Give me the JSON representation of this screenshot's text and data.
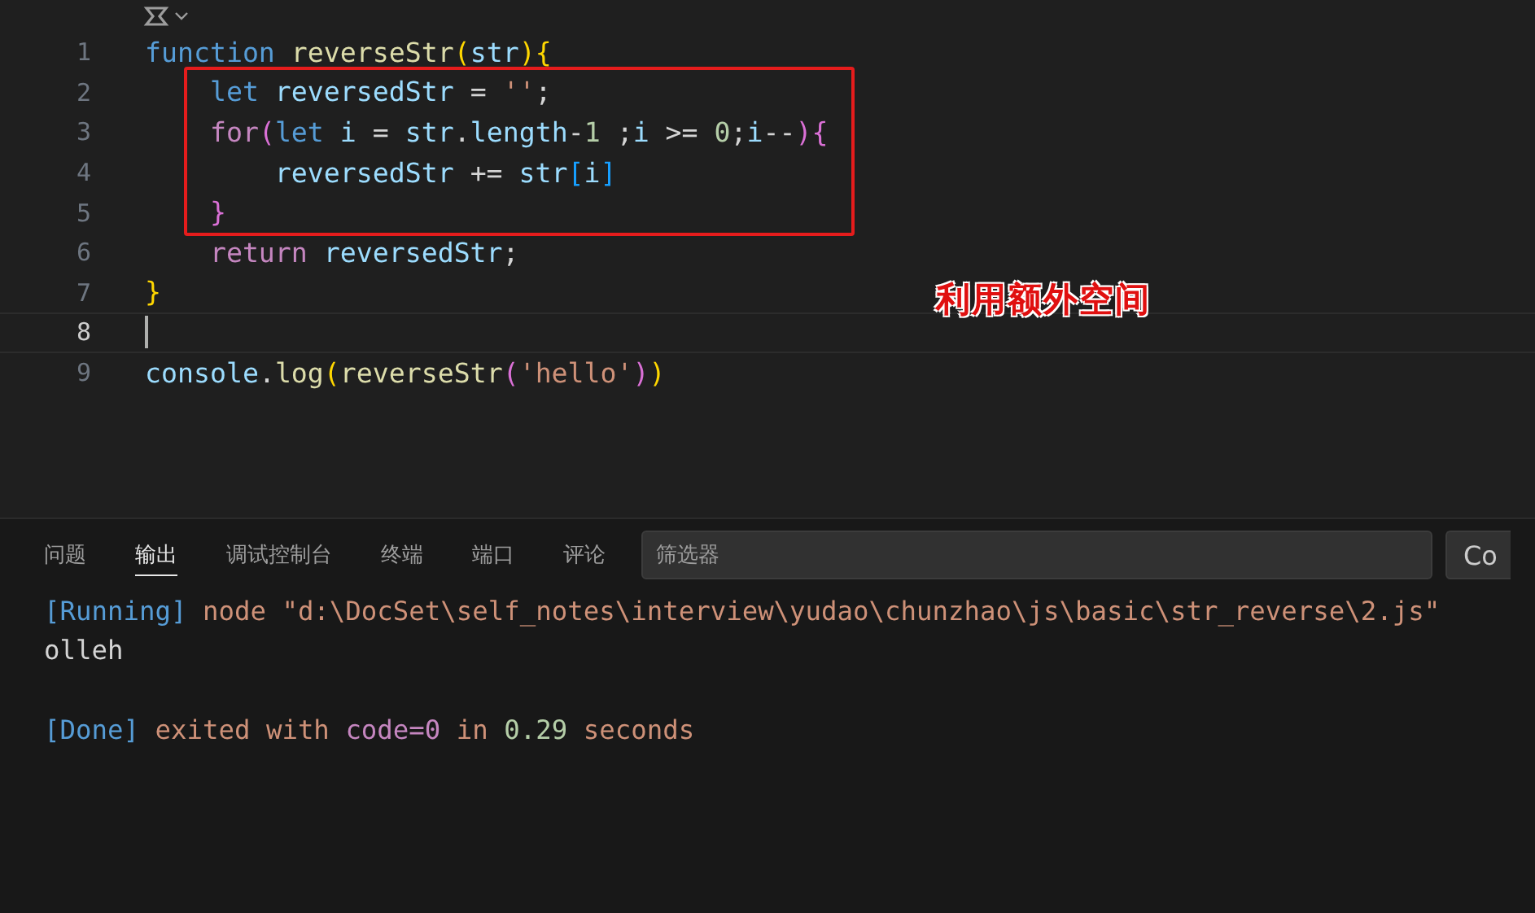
{
  "editor": {
    "lines": [
      {
        "number": "1",
        "current": false,
        "tokens": [
          {
            "text": "function",
            "kind": "keyword"
          },
          {
            "text": " reverseStr",
            "kind": "function"
          },
          {
            "text": "(",
            "kind": "bracket1"
          },
          {
            "text": "str",
            "kind": "variable"
          },
          {
            "text": ")",
            "kind": "bracket1"
          },
          {
            "text": "{",
            "kind": "bracket1"
          }
        ]
      },
      {
        "number": "2",
        "current": false,
        "tokens": [
          {
            "text": "    let",
            "kind": "keyword"
          },
          {
            "text": " reversedStr",
            "kind": "variable"
          },
          {
            "text": " = ",
            "kind": "plain"
          },
          {
            "text": "''",
            "kind": "string"
          },
          {
            "text": ";",
            "kind": "plain"
          }
        ]
      },
      {
        "number": "3",
        "current": false,
        "tokens": [
          {
            "text": "    for",
            "kind": "control"
          },
          {
            "text": "(",
            "kind": "bracket2"
          },
          {
            "text": "let",
            "kind": "keyword"
          },
          {
            "text": " i",
            "kind": "variable"
          },
          {
            "text": " = ",
            "kind": "plain"
          },
          {
            "text": "str",
            "kind": "variable"
          },
          {
            "text": ".",
            "kind": "plain"
          },
          {
            "text": "length",
            "kind": "variable"
          },
          {
            "text": "-",
            "kind": "plain"
          },
          {
            "text": "1",
            "kind": "number"
          },
          {
            "text": " ;",
            "kind": "plain"
          },
          {
            "text": "i",
            "kind": "variable"
          },
          {
            "text": " >= ",
            "kind": "plain"
          },
          {
            "text": "0",
            "kind": "number"
          },
          {
            "text": ";",
            "kind": "plain"
          },
          {
            "text": "i",
            "kind": "variable"
          },
          {
            "text": "--",
            "kind": "plain"
          },
          {
            "text": ")",
            "kind": "bracket2"
          },
          {
            "text": "{",
            "kind": "bracket2"
          }
        ]
      },
      {
        "number": "4",
        "current": false,
        "tokens": [
          {
            "text": "        reversedStr",
            "kind": "variable"
          },
          {
            "text": " += ",
            "kind": "plain"
          },
          {
            "text": "str",
            "kind": "variable"
          },
          {
            "text": "[",
            "kind": "bracket3"
          },
          {
            "text": "i",
            "kind": "variable"
          },
          {
            "text": "]",
            "kind": "bracket3"
          }
        ]
      },
      {
        "number": "5",
        "current": false,
        "tokens": [
          {
            "text": "    }",
            "kind": "bracket2"
          }
        ]
      },
      {
        "number": "6",
        "current": false,
        "tokens": [
          {
            "text": "    return",
            "kind": "control"
          },
          {
            "text": " reversedStr",
            "kind": "variable"
          },
          {
            "text": ";",
            "kind": "plain"
          }
        ]
      },
      {
        "number": "7",
        "current": false,
        "tokens": [
          {
            "text": "}",
            "kind": "bracket1"
          }
        ]
      },
      {
        "number": "8",
        "current": true
      },
      {
        "number": "9",
        "current": false,
        "tokens": [
          {
            "text": "console",
            "kind": "variable"
          },
          {
            "text": ".",
            "kind": "plain"
          },
          {
            "text": "log",
            "kind": "function"
          },
          {
            "text": "(",
            "kind": "bracket1"
          },
          {
            "text": "reverseStr",
            "kind": "function"
          },
          {
            "text": "(",
            "kind": "bracket2"
          },
          {
            "text": "'hello'",
            "kind": "string"
          },
          {
            "text": ")",
            "kind": "bracket2"
          },
          {
            "text": ")",
            "kind": "bracket1"
          }
        ]
      }
    ]
  },
  "annotation": {
    "text": "利用额外空间"
  },
  "panel": {
    "tabs": [
      {
        "label": "问题",
        "selected": false
      },
      {
        "label": "输出",
        "selected": true
      },
      {
        "label": "调试控制台",
        "selected": false
      },
      {
        "label": "终端",
        "selected": false
      },
      {
        "label": "端口",
        "selected": false
      },
      {
        "label": "评论",
        "selected": false
      }
    ],
    "filter": {
      "placeholder": "筛选器"
    },
    "button": "Co",
    "output": [
      {
        "kind": "text",
        "segments": [
          {
            "text": "[Running]",
            "kind": "tag"
          },
          {
            "text": " node \"d:\\DocSet\\self_notes\\interview\\yudao\\chunzhao\\js\\basic\\str_reverse\\2.js\"",
            "kind": "string"
          }
        ]
      },
      {
        "kind": "text",
        "segments": [
          {
            "text": "olleh",
            "kind": "plain"
          }
        ]
      },
      {
        "kind": "blank"
      },
      {
        "kind": "text",
        "segments": [
          {
            "text": "[Done]",
            "kind": "tag"
          },
          {
            "text": " exited with ",
            "kind": "string"
          },
          {
            "text": "code=0",
            "kind": "purple"
          },
          {
            "text": " in ",
            "kind": "string"
          },
          {
            "text": "0.29",
            "kind": "number"
          },
          {
            "text": " seconds",
            "kind": "string"
          }
        ]
      }
    ]
  }
}
